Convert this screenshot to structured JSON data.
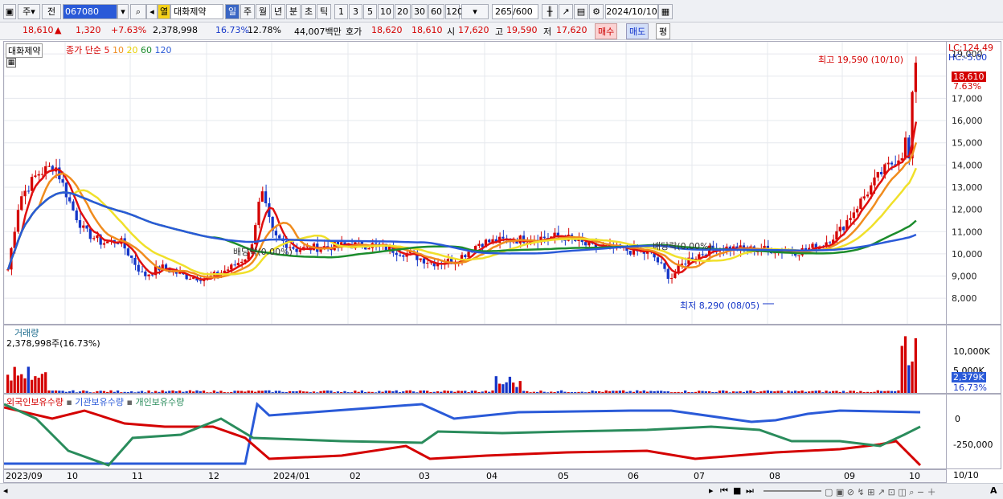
{
  "toolbar": {
    "market": "주",
    "type": "전",
    "code": "067080",
    "mkt": "열",
    "name": "대화제약",
    "periods": [
      "일",
      "주",
      "월",
      "년",
      "분",
      "초",
      "틱"
    ],
    "active_period": "일",
    "nums": [
      "1",
      "3",
      "5",
      "10",
      "20",
      "30",
      "60",
      "120"
    ],
    "count": "265",
    "count_total": "/600",
    "date": "2024/10/10"
  },
  "quote": {
    "price": "18,610",
    "arrow": "▲",
    "change": "1,320",
    "pct": "+7.63%",
    "volume": "2,378,998",
    "turnover": "16.73%",
    "rate": "12.78%",
    "amount": "44,007백만",
    "bid_label": "호가",
    "ask": "18,620",
    "bid": "18,610",
    "open_l": "시",
    "open": "17,620",
    "high_l": "고",
    "high": "19,590",
    "low_l": "저",
    "low": "17,620",
    "buy": "매수",
    "sell": "매도",
    "eval": "평"
  },
  "price_panel": {
    "name": "대화제약",
    "ma_title": "종가 단순",
    "ma": [
      "5",
      "10",
      "20",
      "60",
      "120"
    ],
    "lc": "LC:124.49",
    "hc": "HC:-5.00",
    "cur": "18,610",
    "cur_pct": "7.63%",
    "high_note": "최고 19,590 (10/10)",
    "low_note": "최저 8,290 (08/05)",
    "div1": "배당락(0.00%)",
    "div2": "배당락(0.00%)",
    "yticks": [
      "19,000",
      "18,000",
      "17,000",
      "16,000",
      "15,000",
      "14,000",
      "13,000",
      "12,000",
      "11,000",
      "10,000",
      "9,000",
      "8,000"
    ]
  },
  "volume_panel": {
    "title": "거래량",
    "value": "2,378,998주(16.73%)",
    "yticks": [
      "10,000K",
      "5,000K"
    ],
    "cur": "2,379K",
    "cur_pct": "16.73%"
  },
  "holder_panel": {
    "s1": "외국인보유수량",
    "s2": "기관보유수량",
    "s3": "개인보유수량",
    "yticks": [
      "0",
      "-250,000"
    ]
  },
  "xaxis": [
    "2023/09",
    "10",
    "11",
    "12",
    "2024/01",
    "02",
    "03",
    "04",
    "05",
    "06",
    "07",
    "08",
    "09",
    "10"
  ],
  "xaxis_right": "10/10",
  "colors": {
    "up": "#d40000",
    "down": "#1436c8",
    "ma5": "#e01010",
    "ma10": "#f08c1e",
    "ma20": "#f0e02a",
    "ma60": "#1c8c2c",
    "ma120": "#2a5ad8"
  }
}
